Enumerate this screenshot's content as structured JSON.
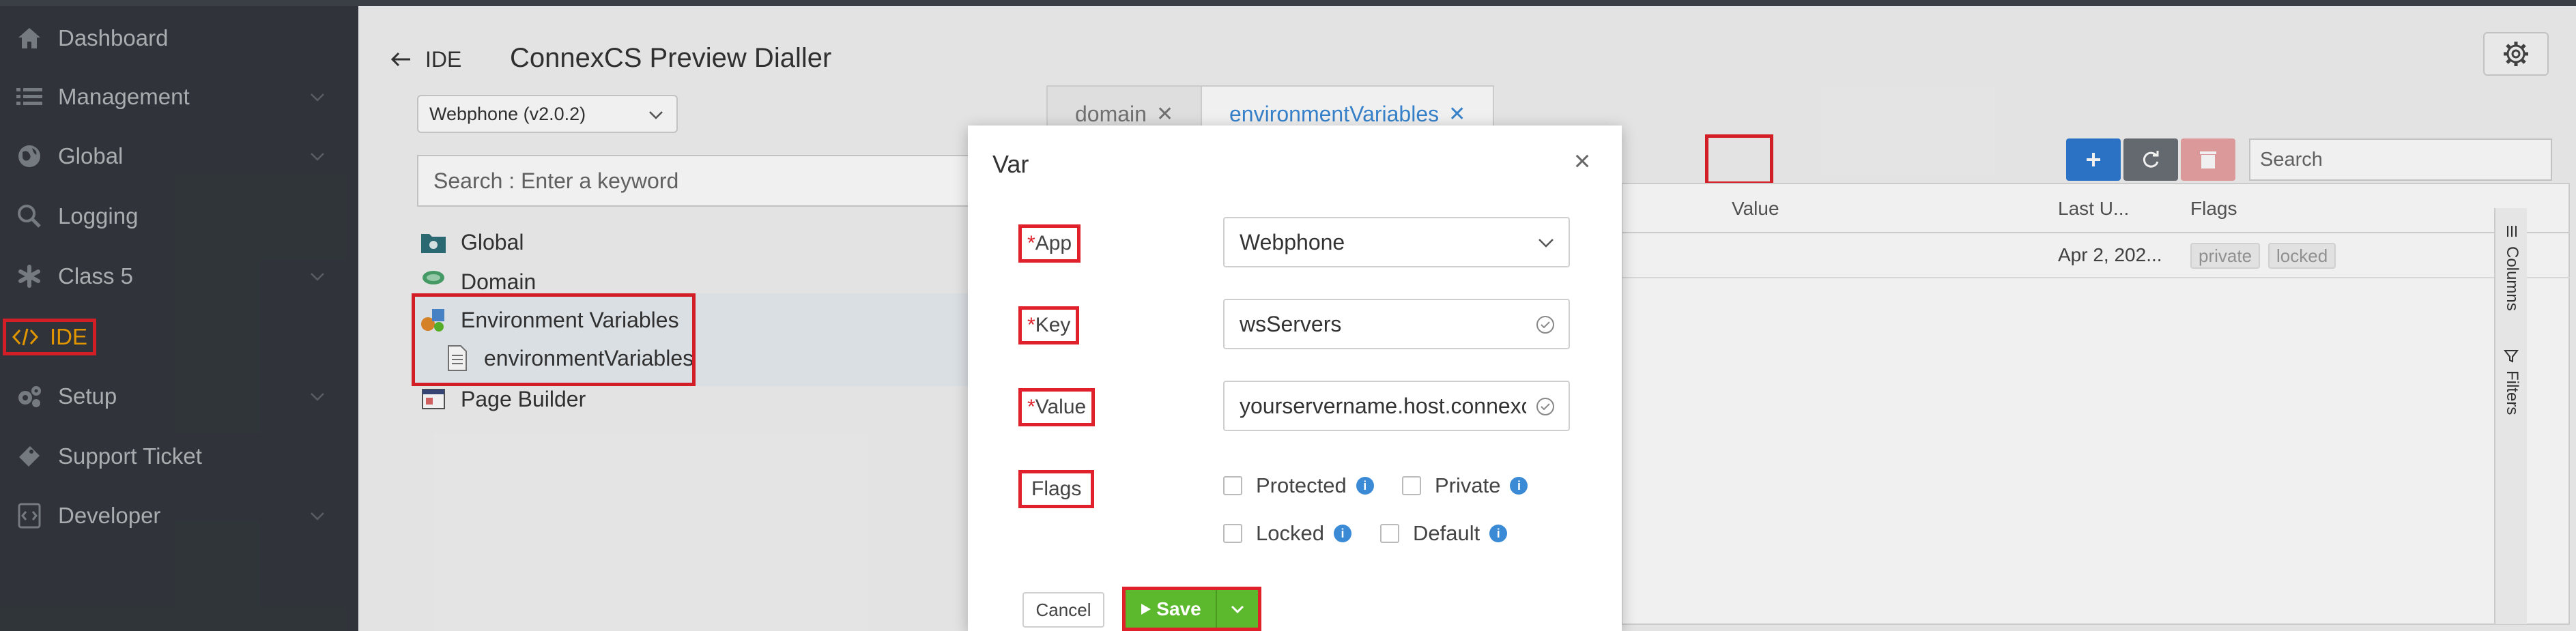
{
  "sidebar": {
    "items": [
      {
        "label": "Dashboard",
        "icon": "home-icon",
        "has_chevron": false
      },
      {
        "label": "Management",
        "icon": "list-icon",
        "has_chevron": true
      },
      {
        "label": "Global",
        "icon": "globe-icon",
        "has_chevron": true
      },
      {
        "label": "Logging",
        "icon": "search-icon",
        "has_chevron": false
      },
      {
        "label": "Class 5",
        "icon": "asterisk-icon",
        "has_chevron": true
      },
      {
        "label": "IDE",
        "icon": "code-icon",
        "has_chevron": false,
        "active": true
      },
      {
        "label": "Setup",
        "icon": "cogs-icon",
        "has_chevron": true
      },
      {
        "label": "Support Ticket",
        "icon": "ticket-icon",
        "has_chevron": false
      },
      {
        "label": "Developer",
        "icon": "developer-icon",
        "has_chevron": true
      }
    ]
  },
  "header": {
    "breadcrumb": "IDE",
    "title": "ConnexCS Preview Dialler"
  },
  "left_panel": {
    "app_select_value": "Webphone (v2.0.2)",
    "search_placeholder": "Search : Enter a keyword",
    "tree": [
      {
        "label": "Global"
      },
      {
        "label": "Domain"
      },
      {
        "label": "Environment Variables"
      },
      {
        "label": "environmentVariables"
      },
      {
        "label": "Page Builder"
      }
    ]
  },
  "tabs": [
    {
      "label": "domain",
      "close": "✕"
    },
    {
      "label": "environmentVariables",
      "close": "✕",
      "active": true
    }
  ],
  "grid": {
    "search_placeholder": "Search",
    "columns": [
      "Value",
      "Last U...",
      "Flags"
    ],
    "rows": [
      {
        "last_updated": "Apr 2, 202...",
        "flags": [
          "private",
          "locked"
        ]
      }
    ],
    "side_tabs": [
      "Columns",
      "Filters"
    ]
  },
  "modal": {
    "title": "Var",
    "close": "×",
    "fields": {
      "app": {
        "label": "App",
        "value": "Webphone"
      },
      "key": {
        "label": "Key",
        "value": "wsServers"
      },
      "value": {
        "label": "Value",
        "value": "yourservername.host.connexc"
      },
      "flags": {
        "label": "Flags"
      }
    },
    "required_mark": "*",
    "checkboxes": {
      "protected": "Protected",
      "private": "Private",
      "locked": "Locked",
      "default": "Default"
    },
    "cancel_label": "Cancel",
    "save_label": "Save"
  },
  "colors": {
    "sidebar_bg": "#33383e",
    "highlight": "#e0202a",
    "accent_blue": "#3a8ad6",
    "save_green": "#5cb82c",
    "active_nav": "#f0a000"
  }
}
